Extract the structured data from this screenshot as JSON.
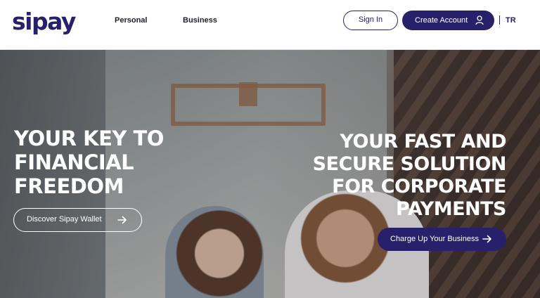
{
  "header": {
    "logo_text": "sipay",
    "nav": [
      {
        "label": "Personal"
      },
      {
        "label": "Business"
      }
    ],
    "sign_in_label": "Sign In",
    "create_account_label": "Create Account",
    "create_account_icon": "user-icon",
    "language_label": "TR"
  },
  "hero": {
    "left": {
      "title": "YOUR KEY TO FINANCIAL FREEDOM",
      "button_label": "Discover Sipay Wallet",
      "button_icon": "arrow-right-icon"
    },
    "right": {
      "title": "YOUR FAST AND SECURE SOLUTION FOR CORPORATE PAYMENTS",
      "button_label": "Charge Up Your Business",
      "button_icon": "arrow-right-icon"
    },
    "background_image": "cafe-couple-photo"
  },
  "colors": {
    "brand": "#27206b",
    "text_light": "#ffffff",
    "nav_text": "#1f1f33"
  }
}
